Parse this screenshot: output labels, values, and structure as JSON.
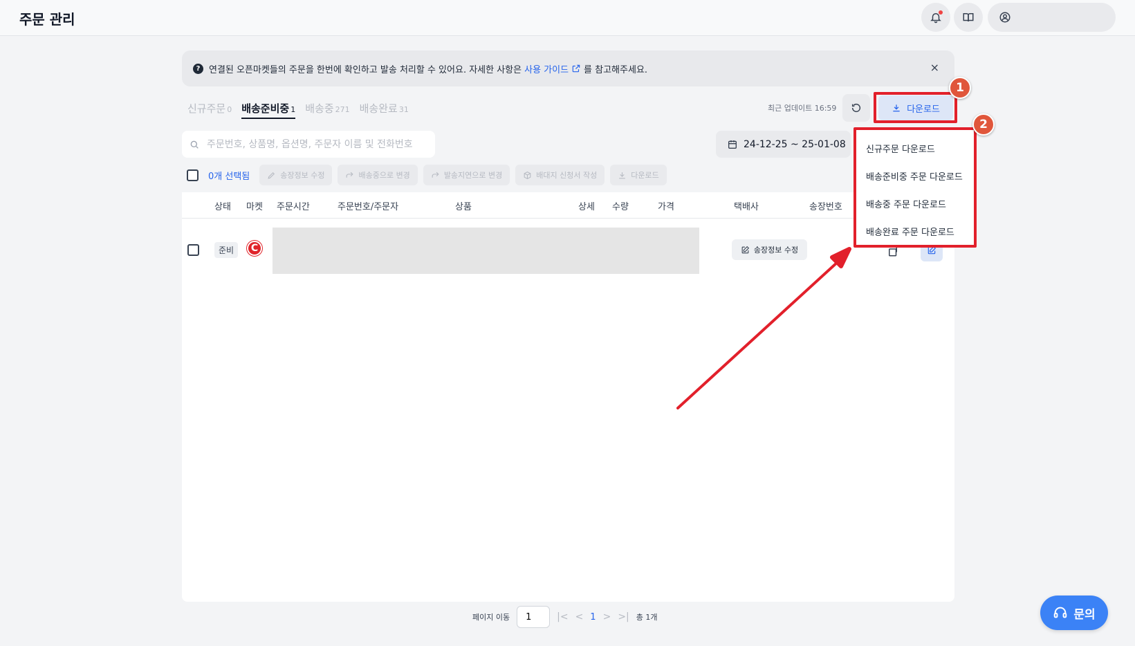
{
  "header": {
    "title": "주문 관리",
    "icons": [
      "bell-icon",
      "book-icon",
      "user-circle-icon"
    ]
  },
  "banner": {
    "text_before": "연결된 오픈마켓들의 주문을 한번에 확인하고 발송 처리할 수 있어요. 자세한 사항은",
    "link_label": "사용 가이드",
    "text_after": "를 참고해주세요.",
    "close": "×"
  },
  "tabs": [
    {
      "label": "신규주문",
      "count": "0"
    },
    {
      "label": "배송준비중",
      "count": "1"
    },
    {
      "label": "배송중",
      "count": "271"
    },
    {
      "label": "배송완료",
      "count": "31"
    }
  ],
  "toolbar": {
    "last_update": "최근 업데이트 16:59",
    "download_label": "다운로드"
  },
  "search": {
    "placeholder": "주문번호, 상품명, 옵션명, 주문자 이름 및 전화번호"
  },
  "date_range": "24-12-25 ~ 25-01-08",
  "actions": {
    "selected_label": "0개 선택됨",
    "buttons": [
      "송장정보 수정",
      "배송중으로 변경",
      "발송지연으로 변경",
      "배대지 신청서 작성",
      "다운로드"
    ]
  },
  "table": {
    "headers": [
      "상태",
      "마켓",
      "주문시간",
      "주문번호/주문자",
      "상품",
      "상세",
      "수량",
      "가격",
      "택배사",
      "송장번호"
    ],
    "row": {
      "status": "준비",
      "market_logo": "C",
      "invoice_edit_label": "송장정보 수정"
    }
  },
  "dropdown": {
    "items": [
      "신규주문 다운로드",
      "배송준비중 주문 다운로드",
      "배송중 주문 다운로드",
      "배송완료 주문 다운로드"
    ]
  },
  "markers": [
    "1",
    "2"
  ],
  "pagination": {
    "goto_label": "페이지 이동",
    "page_input_value": "1",
    "first": "|<",
    "prev": "<",
    "current": "1",
    "next": ">",
    "last": ">|",
    "total": "총 1개"
  },
  "inquiry": {
    "label": "문의"
  },
  "colors": {
    "accent": "#2563eb",
    "highlight": "#e2202b",
    "marker": "#e0563b",
    "background": "#f3f4f6"
  }
}
